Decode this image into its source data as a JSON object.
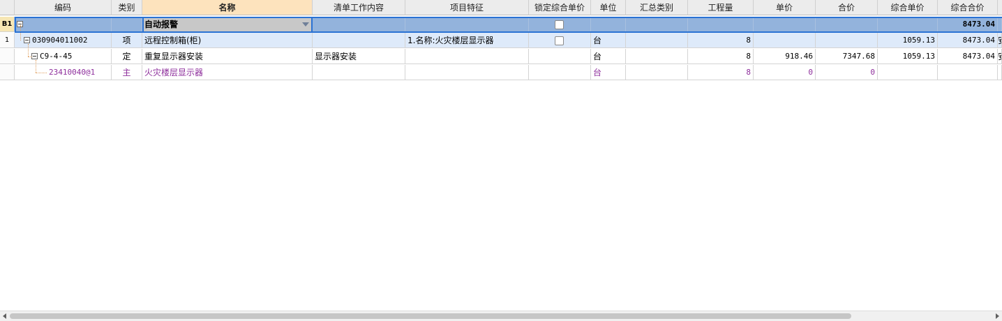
{
  "columns": {
    "code": "编码",
    "type": "类别",
    "name": "名称",
    "work_content": "清单工作内容",
    "features": "项目特征",
    "lock_price": "锁定综合单价",
    "unit": "单位",
    "summary_type": "汇总类别",
    "quantity": "工程量",
    "unit_price": "单价",
    "total_price": "合价",
    "comp_unit_price": "综合单价",
    "comp_total": "综合合价"
  },
  "rows": {
    "b1": {
      "row_label": "B1",
      "name": "自动报警",
      "comp_total": "8473.04",
      "edge": ""
    },
    "r1": {
      "row_label": "1",
      "code": "030904011002",
      "type": "项",
      "name": "远程控制箱(柜)",
      "features": "1.名称:火灾楼层显示器",
      "unit": "台",
      "quantity": "8",
      "comp_unit_price": "1059.13",
      "comp_total": "8473.04",
      "edge": "安"
    },
    "r2": {
      "code": "C9-4-45",
      "type": "定",
      "name": "重复显示器安装",
      "work_content": "显示器安装",
      "unit": "台",
      "quantity": "8",
      "unit_price": "918.46",
      "total_price": "7347.68",
      "comp_unit_price": "1059.13",
      "comp_total": "8473.04",
      "edge": "安"
    },
    "r3": {
      "code": "23410040@1",
      "type": "主",
      "name": "火灾楼层显示器",
      "unit": "台",
      "quantity": "8",
      "unit_price": "0",
      "total_price": "0"
    }
  },
  "colors": {
    "selected_row": "#93b3dc",
    "highlight_row": "#deeafa",
    "material_text": "#8e2f9c",
    "active_header": "#fde3bd",
    "selection_border": "#2a72d4"
  },
  "icons": {
    "expand_toggle": "minus-box-icon",
    "dropdown": "chevron-down-icon",
    "checkbox": "checkbox-icon"
  }
}
